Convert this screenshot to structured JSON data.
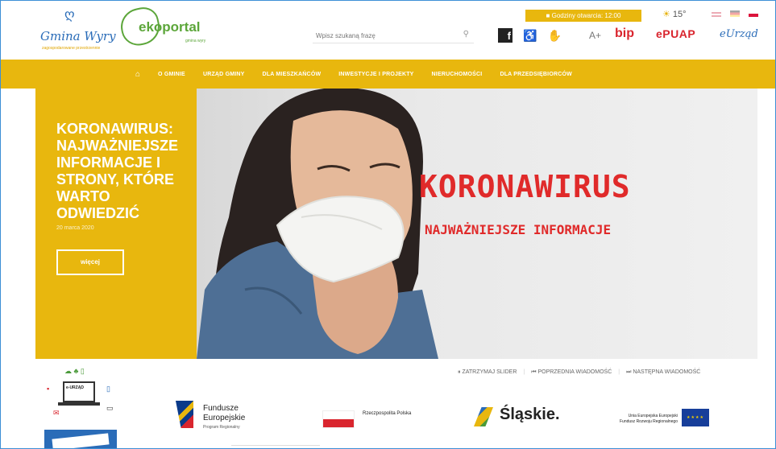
{
  "header": {
    "gmina_logo_text": "Gmina Wyry",
    "gmina_logo_tagline": "zagospodarowane przestrzennie",
    "ekoportal_text": "ekoportal",
    "ekoportal_sub": "gmina wyry",
    "top_strip": "Godziny otwarcia: 12:00",
    "weather_temp": "15°",
    "search_placeholder": "Wpisz szukaną frazę",
    "font_size_label": "A+",
    "bip_label": "bip",
    "epuap_label": "ePUAP",
    "eurzad_label": "eUrząd",
    "icons": [
      "search-icon",
      "facebook-icon",
      "accessibility-icon",
      "deaf-icon",
      "sun-icon"
    ],
    "languages": [
      "en",
      "de",
      "pl"
    ]
  },
  "nav": {
    "items": [
      "O GMINIE",
      "URZĄD GMINY",
      "DLA MIESZKAŃCÓW",
      "INWESTYCJE I PROJEKTY",
      "NIERUCHOMOŚCI",
      "DLA PRZEDSIĘBIORCÓW"
    ]
  },
  "slider": {
    "title": "KORONAWIRUS: NAJWAŻNIEJSZE INFORMACJE I STRONY, KTÓRE WARTO ODWIEDZIĆ",
    "date": "20 marca 2020",
    "more_label": "więcej",
    "image_headline": "KORONAWIRUS",
    "image_subheadline": "NAJWAŻNIEJSZE INFORMACJE",
    "controls": {
      "pause": "⏸ ZATRZYMAJ SLIDER",
      "prev": "⏮ POPRZEDNIA WIADOMOŚĆ",
      "next": "⏭ NASTĘPNA WIADOMOŚĆ"
    }
  },
  "logos": {
    "fe_line1": "Fundusze",
    "fe_line2": "Europejskie",
    "fe_sub": "Program Regionalny",
    "rp_text": "Rzeczpospolita Polska",
    "slaskie": "Śląskie.",
    "ue_text": "Unia Europejska Europejski Fundusz Rozwoju Regionalnego",
    "promo_laptop_text": "e-URZĄD"
  },
  "colors": {
    "accent": "#e8b70e",
    "red": "#e02a2a",
    "blue": "#2a6cb8"
  }
}
